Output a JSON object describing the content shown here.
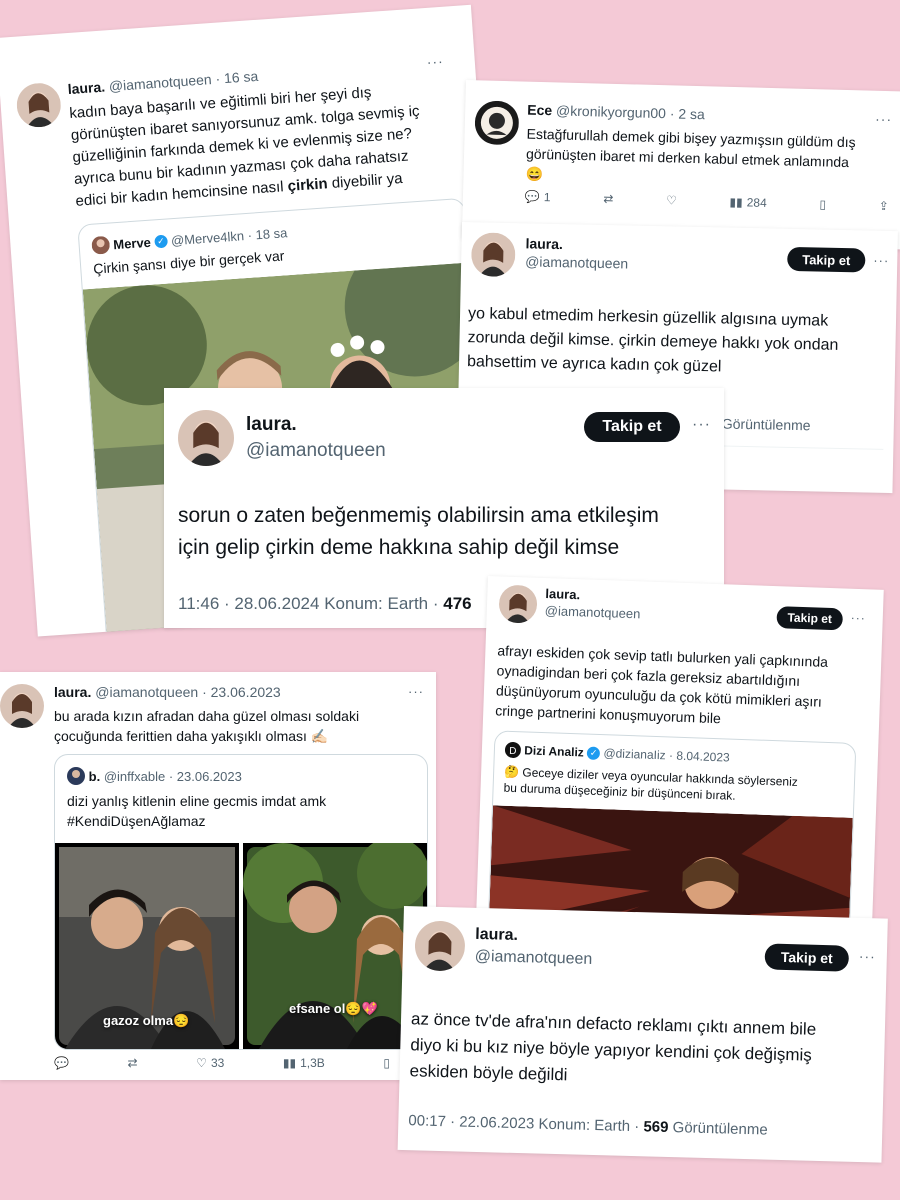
{
  "tweet1": {
    "name": "laura.",
    "handle": "@iamanotqueen",
    "time": "· 16 sa",
    "text_lines": [
      "kadın baya başarılı ve eğitimli biri her şeyi dış",
      "görünüşten ibaret sanıyorsunuz amk. tolga sevmiş iç",
      "güzelliğinin farkında demek ki ve evlenmiş size ne?",
      "ayrıca bunu bir kadının yazması çok daha rahatsız"
    ],
    "last_line_prefix": "edici bir kadın hemcinsine nasıl",
    "last_line_bold": "çirkin",
    "last_line_suffix": "diyebilir ya",
    "quote": {
      "name": "Merve",
      "handle": "@Merve4lkn",
      "time": "· 18 sa",
      "text": "Çirkin şansı diye bir gerçek var"
    }
  },
  "tweet2": {
    "name": "Ece",
    "handle": "@kronikyorgun00",
    "time": "· 2 sa",
    "text_lines": [
      "Estağfurullah demek gibi bişey yazmışsın güldüm dış",
      "görünüşten ibaret mi derken kabul etmek anlamında"
    ],
    "emoji": "😄",
    "replies": "1",
    "views": "284"
  },
  "tweet3": {
    "name": "laura.",
    "handle": "@iamanotqueen",
    "follow": "Takip et",
    "text_lines": [
      "yo kabul etmedim herkesin güzellik algısına uymak",
      "zorunda değil kimse. çirkin demeye hakkı yok ondan",
      "bahsettim ve ayrıca kadın çok güzel"
    ],
    "views_label": "Görüntülenme"
  },
  "tweet4": {
    "name": "laura.",
    "handle": "@iamanotqueen",
    "follow": "Takip et",
    "text_lines": [
      "sorun o zaten beğenmemiş olabilirsin ama etkileşim",
      "için gelip çirkin deme hakkına sahip değil kimse"
    ],
    "meta": "11:46 · 28.06.2024 Konum: Earth ·",
    "views": "476"
  },
  "tweet5": {
    "name": "laura.",
    "handle": "@iamanotqueen",
    "follow": "Takip et",
    "text_lines": [
      "afrayı eskiden çok sevip tatlı bulurken yali çapkınında",
      "oynadigindan beri çok fazla gereksiz abartıldığını",
      "düşünüyorum oyunculuğu da çok kötü mimikleri aşırı",
      "cringe partnerini konuşmuyorum bile"
    ],
    "quote": {
      "name": "Dizi Analiz",
      "handle": "@dizianaIiz",
      "time": "· 8.04.2023",
      "text_lines": [
        "🤔 Geceye diziler veya oyuncular hakkında söylerseniz",
        "bu duruma düşeceğiniz bir düşünceni bırak."
      ]
    }
  },
  "tweet6": {
    "name": "laura.",
    "handle": "@iamanotqueen",
    "time": "· 23.06.2023",
    "text_lines": [
      "bu arada kızın afradan daha güzel olması soldaki",
      "çocuğunda ferittien daha yakışıklı olması ✍🏻"
    ],
    "quote": {
      "name": "b.",
      "handle": "@inffxable",
      "time": "· 23.06.2023",
      "text_lines": [
        "dizi yanlış kitlenin eline gecmis imdat amk",
        "#KendiDüşenAğlamaz"
      ],
      "caption_left": "gazoz olma😔",
      "caption_right": "efsane ol😔💖"
    },
    "likes": "33",
    "views": "1,3B"
  },
  "tweet7": {
    "name": "laura.",
    "handle": "@iamanotqueen",
    "follow": "Takip et",
    "text_lines": [
      "az önce tv'de afra'nın defacto reklamı çıktı annem bile",
      "diyo ki bu kız niye böyle yapıyor kendini çok değişmiş",
      "eskiden böyle değildi"
    ],
    "meta": "00:17 · 22.06.2023 Konum: Earth ·",
    "views": "569",
    "views_label": "Görüntülenme"
  },
  "more_icon": "···",
  "colors": {
    "background": "#f4c9d6",
    "follow_button": "#0f1419",
    "muted": "#536471",
    "verified": "#1d9bf0"
  }
}
